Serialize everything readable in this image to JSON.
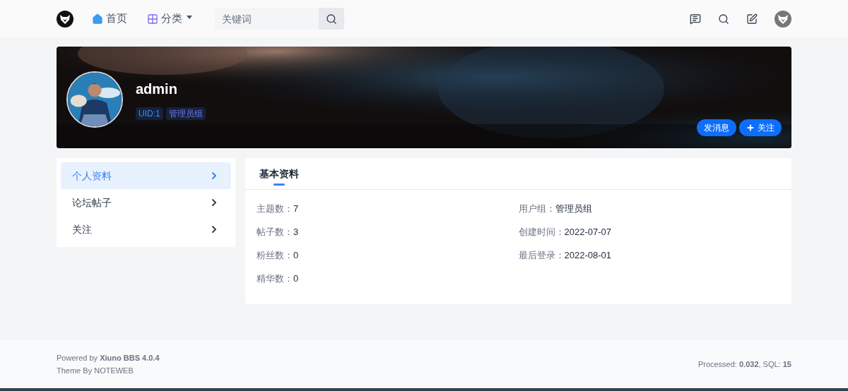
{
  "nav": {
    "items": [
      {
        "label": "首页",
        "kind": "home",
        "selected": false
      },
      {
        "label": "分类",
        "kind": "dropdown",
        "selected": false
      }
    ],
    "search": {
      "placeholder": "关键词"
    }
  },
  "profile": {
    "name": "admin",
    "badges": [
      "UID:1",
      "管理员组"
    ],
    "buttons": [
      {
        "label": "发消息",
        "kind": "plain"
      },
      {
        "label": "关注",
        "kind": "plus"
      }
    ]
  },
  "sidebar": {
    "items": [
      {
        "label": "个人资料",
        "selected": true
      },
      {
        "label": "论坛帖子",
        "selected": false
      },
      {
        "label": "关注",
        "selected": false
      }
    ]
  },
  "tabs": [
    {
      "label": "基本资料",
      "selected": true
    }
  ],
  "fields": [
    {
      "label": "主题数：",
      "value": "7"
    },
    {
      "label": "用户组：",
      "value": "管理员组"
    },
    {
      "label": "帖子数：",
      "value": "3"
    },
    {
      "label": "创建时间：",
      "value": "2022-07-07"
    },
    {
      "label": "粉丝数：",
      "value": "0"
    },
    {
      "label": "最后登录：",
      "value": "2022-08-01"
    },
    {
      "label": "精华数：",
      "value": "0"
    }
  ],
  "footer": {
    "powered": "Powered by **Xiuno BBS 4.0.4**",
    "theme": "Theme By NOTEWEB",
    "stats": "Processed: **0.032**, SQL: **15**"
  }
}
